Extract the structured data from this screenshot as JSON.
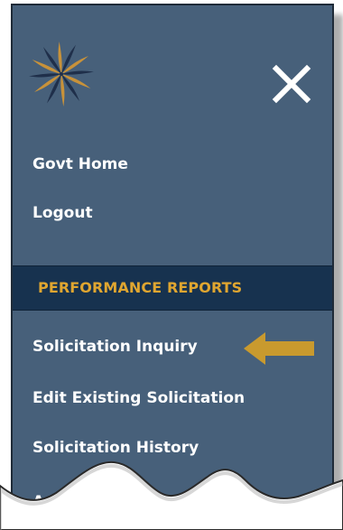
{
  "menu": {
    "top_links": [
      {
        "label": "Govt Home"
      },
      {
        "label": "Logout"
      }
    ],
    "section": {
      "title": "PERFORMANCE REPORTS",
      "items": [
        {
          "label": "Solicitation Inquiry"
        },
        {
          "label": "Edit Existing Solicitation"
        },
        {
          "label": "Solicitation History"
        },
        {
          "label": "Advanced Vendor Schedule"
        }
      ]
    }
  },
  "icons": {
    "logo": "starburst-logo-icon",
    "close": "close-icon",
    "pointer": "left-arrow-icon"
  },
  "colors": {
    "panel_background": "#47607a",
    "section_background": "#17324f",
    "section_text": "#e0a630",
    "arrow": "#c99a2e",
    "link_text": "#ffffff"
  }
}
